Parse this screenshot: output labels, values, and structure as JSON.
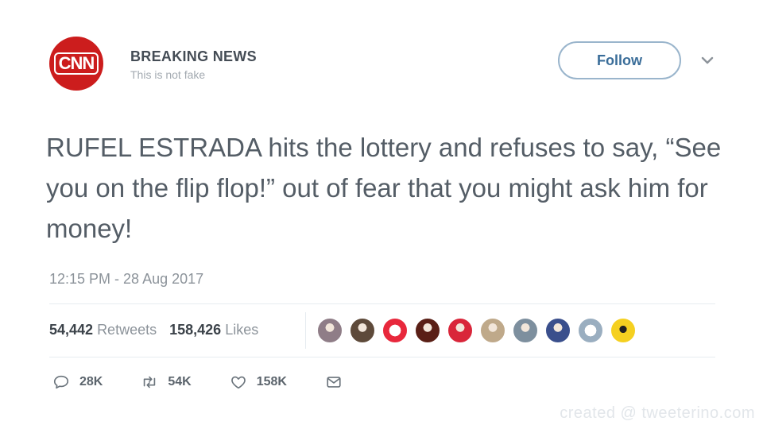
{
  "author": {
    "avatar_text": "CNN",
    "name": "BREAKING  NEWS",
    "handle": "This is not fake"
  },
  "follow_label": "Follow",
  "tweet": {
    "text": "RUFEL ESTRADA hits the lottery and refuses to say, “See you on the flip flop!” out of fear that you might ask him for money!",
    "timestamp": "12:15 PM - 28 Aug 2017"
  },
  "stats": {
    "retweets_count": "54,442",
    "retweets_label": "Retweets",
    "likes_count": "158,426",
    "likes_label": "Likes"
  },
  "likers": [
    {
      "color": "#8f7d87"
    },
    {
      "color": "#5e4a3a"
    },
    {
      "color": "#e8283c"
    },
    {
      "color": "#5a1f16"
    },
    {
      "color": "#d9263a"
    },
    {
      "color": "#bfa98a"
    },
    {
      "color": "#7d8f9e"
    },
    {
      "color": "#3a4f8c"
    },
    {
      "color": "#9aaec0"
    },
    {
      "color": "#f5d020"
    }
  ],
  "actions": {
    "reply_count": "28K",
    "retweet_count": "54K",
    "like_count": "158K"
  },
  "watermark": "created @ tweeterino.com",
  "colors": {
    "avatar_bg": "#cc1d1d",
    "follow_border": "#9ab5cc",
    "follow_text": "#3a6d99",
    "tweet_text": "#545d66"
  }
}
